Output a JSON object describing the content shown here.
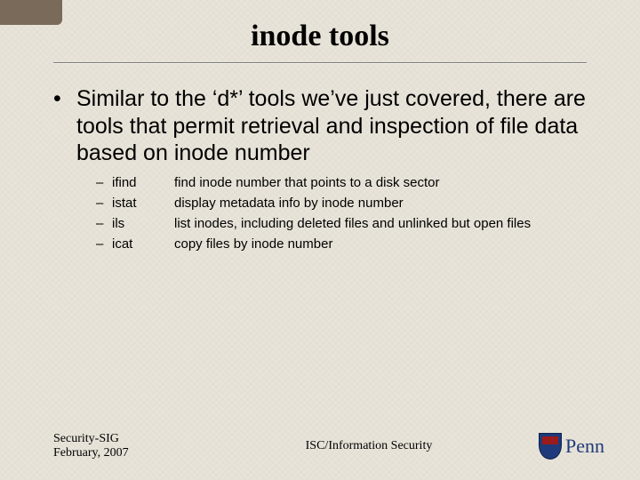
{
  "title": "inode tools",
  "bullet_text": "Similar to the ‘d*’ tools we’ve just covered, there are tools that permit retrieval and inspection of file data based on inode number",
  "tools": [
    {
      "cmd": "ifind",
      "desc": "find inode number that points to a disk sector"
    },
    {
      "cmd": "istat",
      "desc": "display metadata info by inode number"
    },
    {
      "cmd": "ils",
      "desc": "list inodes, including deleted files and unlinked but open files"
    },
    {
      "cmd": "icat",
      "desc": "copy files by inode number"
    }
  ],
  "footer": {
    "left_line1": "Security-SIG",
    "left_line2": "February, 2007",
    "center": "ISC/Information Security",
    "logo_text": "Penn"
  }
}
